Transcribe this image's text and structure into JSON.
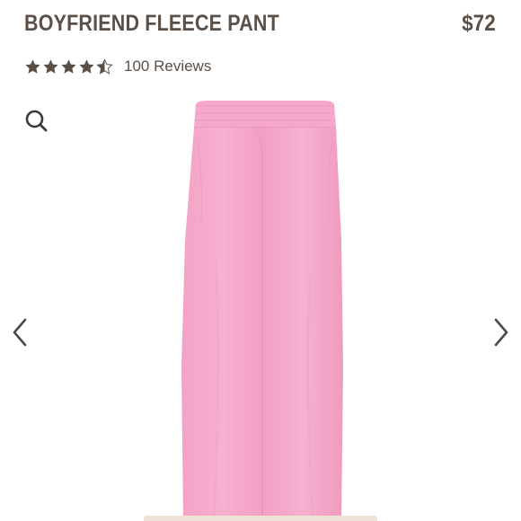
{
  "product": {
    "title": "BOYFRIEND FLEECE PANT",
    "price": "$72"
  },
  "rating": {
    "value": 4.5,
    "max": 5,
    "reviews_label": "100 Reviews"
  },
  "icons": {
    "search": "search-icon",
    "prev": "chevron-left-icon",
    "next": "chevron-right-icon",
    "star": "star-icon"
  },
  "colors": {
    "text": "#5b4f47",
    "star": "#5b4f47",
    "product": "#f5a9cb"
  }
}
